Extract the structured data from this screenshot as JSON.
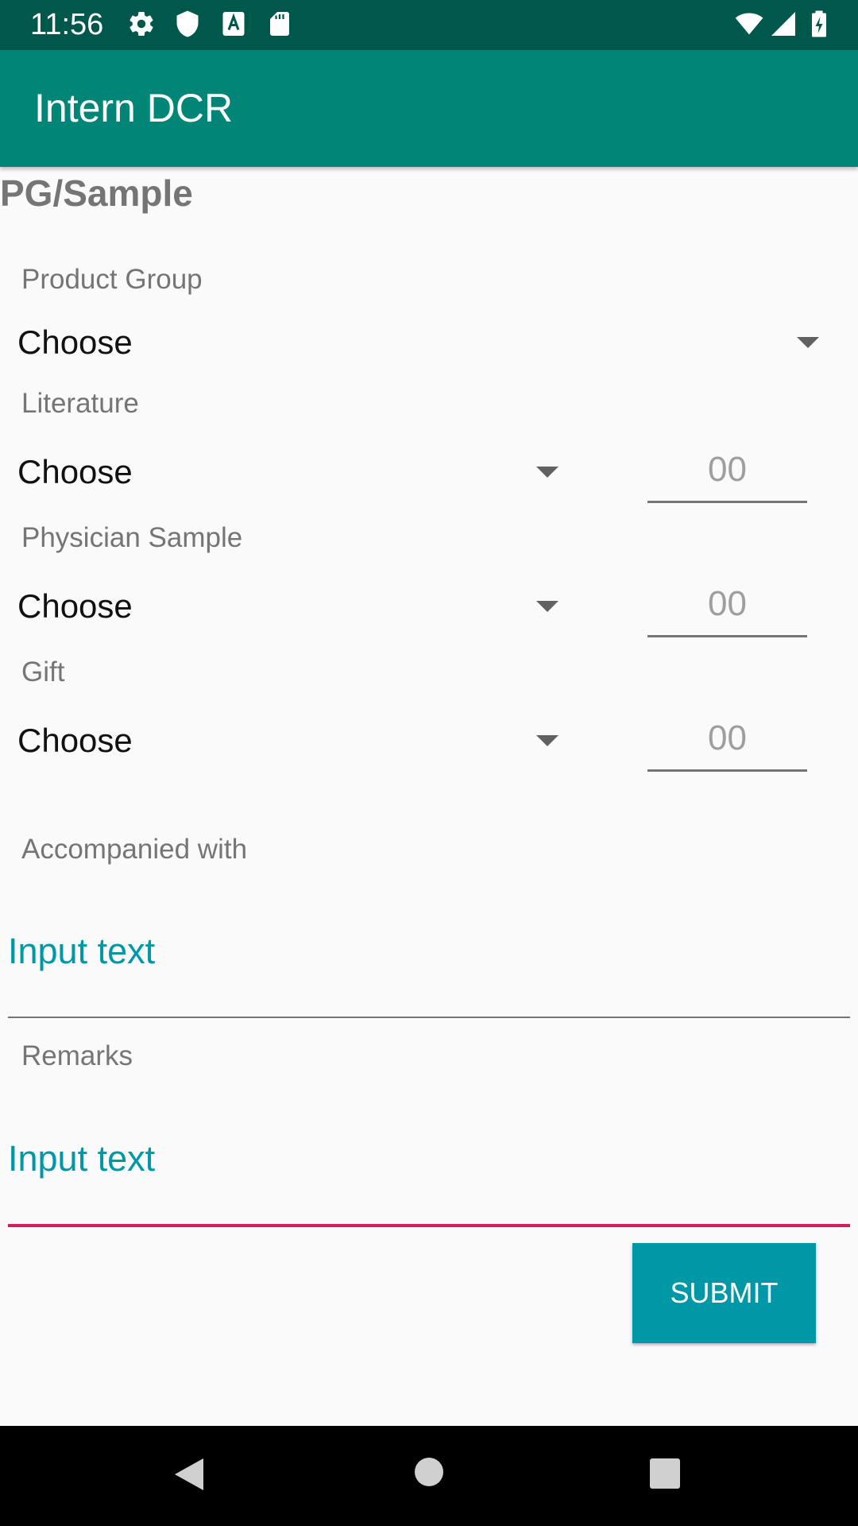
{
  "status_bar": {
    "time": "11:56",
    "left_icons": [
      "settings-icon",
      "shield-icon",
      "font-a-icon",
      "sd-card-icon"
    ],
    "right_icons": [
      "wifi-icon",
      "cell-signal-icon",
      "battery-charging-icon"
    ]
  },
  "app_bar": {
    "title": "Intern DCR",
    "color": "#008577"
  },
  "form": {
    "section_title": "PG/Sample",
    "product_group": {
      "label": "Product Group",
      "selected": "Choose"
    },
    "literature": {
      "label": "Literature",
      "selected": "Choose",
      "qty_placeholder": "00"
    },
    "physician_sample": {
      "label": "Physician Sample",
      "selected": "Choose",
      "qty_placeholder": "00"
    },
    "gift": {
      "label": "Gift",
      "selected": "Choose",
      "qty_placeholder": "00"
    },
    "accompanied_with": {
      "label": "Accompanied with",
      "placeholder": "Input text"
    },
    "remarks": {
      "label": "Remarks",
      "placeholder": "Input text"
    },
    "submit_label": "SUBMIT"
  },
  "colors": {
    "accent": "#0097a7",
    "focus_underline": "#d81b60",
    "status_bar": "#00574b"
  },
  "nav_bar": {
    "icons": [
      "back-icon",
      "home-icon",
      "recents-icon"
    ]
  }
}
